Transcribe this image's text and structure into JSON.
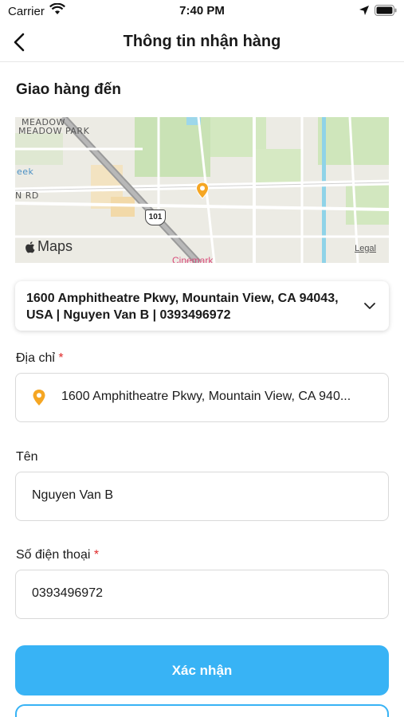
{
  "status_bar": {
    "carrier": "Carrier",
    "time": "7:40 PM"
  },
  "nav": {
    "title": "Thông tin nhận hàng",
    "back_icon": "chevron-left-icon"
  },
  "section_title": "Giao hàng đến",
  "map": {
    "brand": "Maps",
    "legal": "Legal",
    "labels": [
      "MEADOW",
      "MEADOW PARK",
      "N RD",
      "eek"
    ],
    "highway_shield": "101",
    "poi": "Cinemark",
    "pin_color": "#f5a623"
  },
  "selected_address": {
    "text": "1600 Amphitheatre Pkwy, Mountain View, CA 94043, USA | Nguyen Van B | 0393496972",
    "chevron_icon": "chevron-down-icon"
  },
  "address_field": {
    "label": "Địa chỉ",
    "required_mark": "*",
    "value": "1600 Amphitheatre Pkwy, Mountain View, CA 940...",
    "icon": "location-pin-icon"
  },
  "name_field": {
    "label": "Tên",
    "value": "Nguyen Van B"
  },
  "phone_field": {
    "label": "Số điện thoại",
    "required_mark": "*",
    "value": "0393496972"
  },
  "confirm_button": {
    "label": "Xác nhận"
  },
  "colors": {
    "accent": "#38b3f5",
    "required": "#e02b2b",
    "pin": "#f5a623"
  }
}
